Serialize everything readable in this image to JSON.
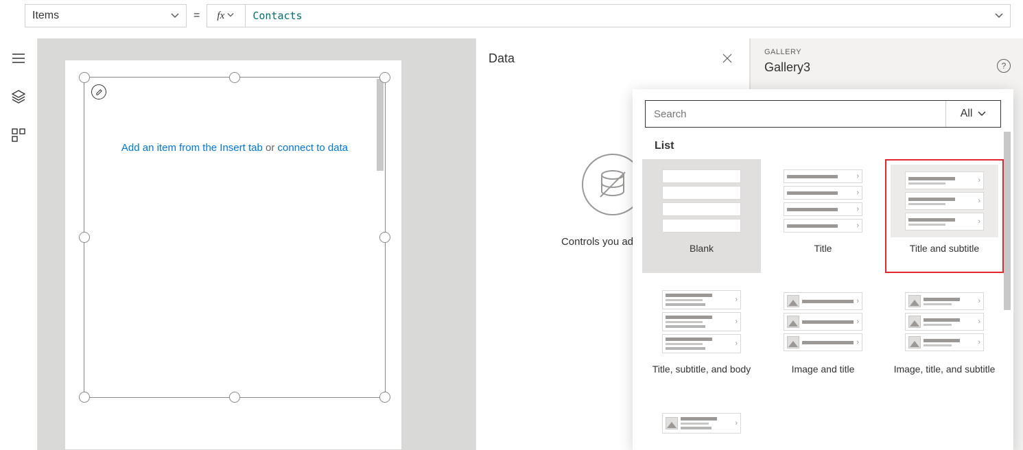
{
  "formula_bar": {
    "property": "Items",
    "fx_label": "fx",
    "value": "Contacts"
  },
  "canvas": {
    "hint_prefix": "Add an item from the Insert tab",
    "hint_mid": " or ",
    "hint_link": "connect to data"
  },
  "data_panel": {
    "title": "Data",
    "empty_text": "Controls you add will s"
  },
  "gallery_panel": {
    "section_label": "GALLERY",
    "control_name": "Gallery3",
    "help": "?"
  },
  "layout_flyout": {
    "search_placeholder": "Search",
    "filter_label": "All",
    "section": "List",
    "tiles": [
      {
        "label": "Blank",
        "kind": "blank",
        "hovered": true
      },
      {
        "label": "Title",
        "kind": "title"
      },
      {
        "label": "Title and subtitle",
        "kind": "title_sub",
        "highlighted": true
      },
      {
        "label": "Title, subtitle, and body",
        "kind": "title_sub_body"
      },
      {
        "label": "Image and title",
        "kind": "img_title"
      },
      {
        "label": "Image, title, and subtitle",
        "kind": "img_title_sub"
      },
      {
        "label": "",
        "kind": "img_title_sub_body"
      }
    ]
  }
}
